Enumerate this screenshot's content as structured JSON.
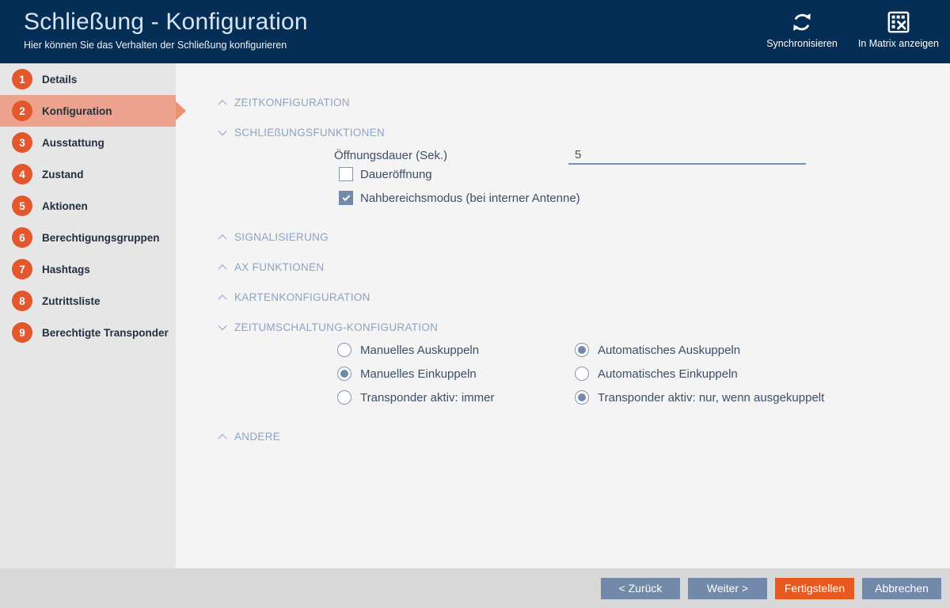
{
  "header": {
    "title": "Schließung - Konfiguration",
    "subtitle": "Hier können Sie das Verhalten der Schließung konfigurieren",
    "actions": [
      {
        "label": "Synchronisieren",
        "icon": "sync-icon"
      },
      {
        "label": "In Matrix anzeigen",
        "icon": "matrix-icon"
      }
    ]
  },
  "sidebar": {
    "items": [
      {
        "number": "1",
        "label": "Details",
        "active": false
      },
      {
        "number": "2",
        "label": "Konfiguration",
        "active": true
      },
      {
        "number": "3",
        "label": "Ausstattung",
        "active": false
      },
      {
        "number": "4",
        "label": "Zustand",
        "active": false
      },
      {
        "number": "5",
        "label": "Aktionen",
        "active": false
      },
      {
        "number": "6",
        "label": "Berechtigungsgruppen",
        "active": false
      },
      {
        "number": "7",
        "label": "Hashtags",
        "active": false
      },
      {
        "number": "8",
        "label": "Zutrittsliste",
        "active": false
      },
      {
        "number": "9",
        "label": "Berechtigte Transponder",
        "active": false
      }
    ]
  },
  "main": {
    "sections": [
      {
        "label": "ZEITKONFIGURATION",
        "state": "collapsed"
      },
      {
        "label": "SCHLIEßUNGSFUNKTIONEN",
        "state": "expanded"
      },
      {
        "label": "SIGNALISIERUNG",
        "state": "collapsed"
      },
      {
        "label": "AX FUNKTIONEN",
        "state": "collapsed"
      },
      {
        "label": "KARTENKONFIGURATION",
        "state": "collapsed"
      },
      {
        "label": "ZEITUMSCHALTUNG-KONFIGURATION",
        "state": "expanded"
      },
      {
        "label": "ANDERE",
        "state": "collapsed"
      }
    ],
    "schliessungsfunktionen": {
      "oeffnungsdauer_label": "Öffnungsdauer (Sek.)",
      "oeffnungsdauer_value": "5",
      "checkboxes": [
        {
          "label": "Daueröffnung",
          "checked": false
        },
        {
          "label": "Nahbereichsmodus (bei interner Antenne)",
          "checked": true
        }
      ]
    },
    "zeitumschaltung": {
      "radios_left": [
        {
          "label": "Manuelles Auskuppeln",
          "selected": false
        },
        {
          "label": "Manuelles Einkuppeln",
          "selected": true
        },
        {
          "label": "Transponder aktiv: immer",
          "selected": false
        }
      ],
      "radios_right": [
        {
          "label": "Automatisches Auskuppeln",
          "selected": true
        },
        {
          "label": "Automatisches Einkuppeln",
          "selected": false
        },
        {
          "label": "Transponder aktiv: nur, wenn ausgekuppelt",
          "selected": true
        }
      ]
    }
  },
  "footer": {
    "buttons": [
      {
        "label": "< Zurück",
        "style": "secondary"
      },
      {
        "label": "Weiter >",
        "style": "secondary"
      },
      {
        "label": "Fertigstellen",
        "style": "primary"
      },
      {
        "label": "Abbrechen",
        "style": "secondary"
      }
    ]
  },
  "colors": {
    "header_bg": "#042e55",
    "title_text": "#d8e5f1",
    "sidebar_bg": "#e6e6e6",
    "active_item_bg": "#eca28c",
    "active_arrow": "#ec9270",
    "step_circle": "#e4562c",
    "content_bg": "#f4f4f4",
    "footer_bg": "#d8d8d8",
    "section_header_text": "#8ba3c6",
    "form_label_text": "#3d4f66",
    "control_accent": "#7389a9",
    "primary_button": "#e7591e"
  }
}
